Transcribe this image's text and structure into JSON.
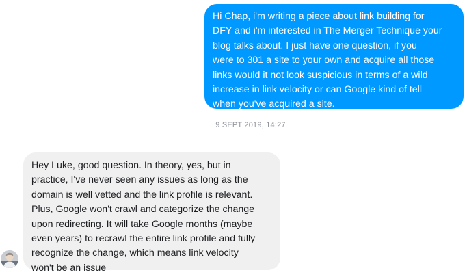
{
  "conversation": {
    "outgoing_message": {
      "lines": [
        "Hi Chap, i'm writing a piece about link building for",
        "DFY and i'm interested in The Merger Technique your",
        "blog talks about. I just have one question, if you",
        "were to 301 a site to your own and acquire all those",
        "links would it not look suspicious in terms of a wild",
        "increase in link velocity or can Google kind of tell",
        "when you've acquired a site."
      ]
    },
    "timestamp": "9 SEPT 2019, 14:27",
    "incoming_message": {
      "lines": [
        "Hey Luke, good question. In theory, yes, but in",
        "practice, I've never seen any issues as long as the",
        "domain is well vetted and the link profile is relevant.",
        "Plus, Google won't crawl and categorize the change",
        "upon redirecting. It will take Google months (maybe",
        "even years) to recrawl the entire link profile and fully",
        "recognize the change, which means link velocity",
        "won't be an issue"
      ],
      "sender_avatar_icon": "user-avatar-icon"
    }
  },
  "colors": {
    "outgoing_bubble": "#0099ff",
    "incoming_bubble": "#f1f0f0",
    "timestamp_text": "#90949c"
  }
}
